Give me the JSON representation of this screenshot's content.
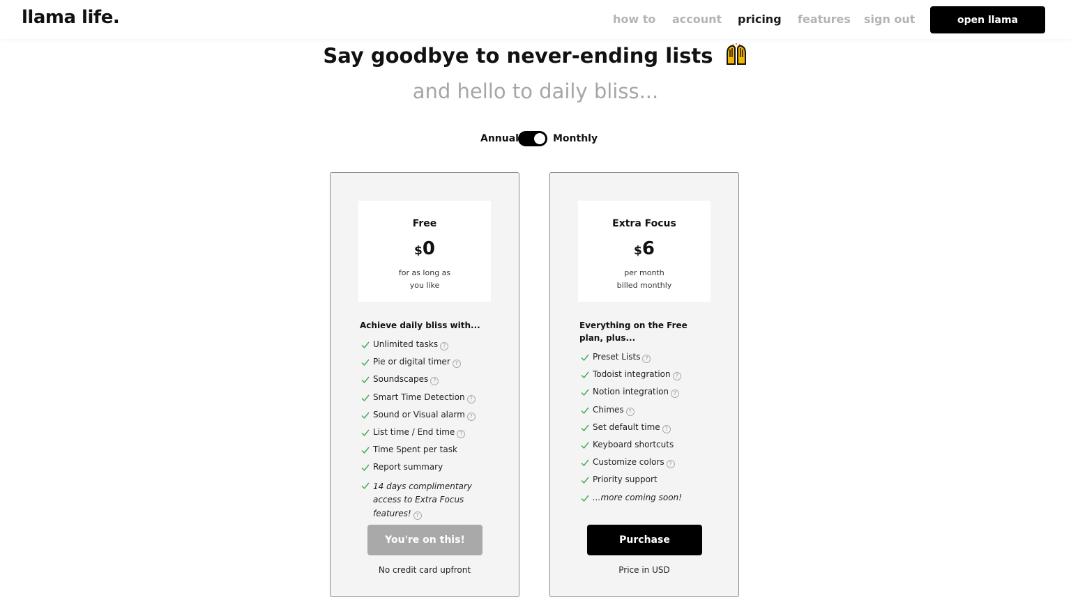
{
  "brand": {
    "logo": "llama life."
  },
  "nav": {
    "items": [
      {
        "label": "how to",
        "active": false
      },
      {
        "label": "account",
        "active": false
      },
      {
        "label": "pricing",
        "active": true
      },
      {
        "label": "features",
        "active": false
      },
      {
        "label": "sign out",
        "active": false
      }
    ],
    "cta_label": "open llama"
  },
  "hero": {
    "title": "Say goodbye to never-ending lists",
    "title_icon": "raising-hands-emoji",
    "subtitle": "and hello to daily bliss..."
  },
  "billing_toggle": {
    "left_label": "Annual",
    "right_label": "Monthly",
    "selected": "Monthly"
  },
  "plans": [
    {
      "name": "Free",
      "currency": "$",
      "price": "0",
      "note_line1": "for as long as",
      "note_line2": "you like",
      "intro": "Achieve daily bliss with...",
      "features": [
        "Unlimited tasks",
        "Pie or digital timer",
        "Soundscapes",
        "Smart Time Detection",
        "Sound or Visual alarm",
        "List time / End time",
        "Time Spent per task",
        "Report summary",
        "14 days complimentary access to Extra Focus features!"
      ],
      "button_label": "You're on this!",
      "footnote": "No credit card upfront"
    },
    {
      "name": "Extra Focus",
      "currency": "$",
      "price": "6",
      "note_line1": "per month",
      "note_line2": "billed monthly",
      "intro": "Everything on the Free plan, plus...",
      "features": [
        "Preset Lists",
        "Todoist integration",
        "Notion integration",
        "Chimes",
        "Set default time",
        "Keyboard shortcuts",
        "Customize colors",
        "Priority support",
        "...more coming soon!"
      ],
      "button_label": "Purchase",
      "footnote": "Price in USD"
    }
  ],
  "colors": {
    "accent": "#000000",
    "check": "#3aa856",
    "muted_nav": "#b3b3b3",
    "card_bg": "#f4f4f4",
    "disabled_button": "#a9a9a9"
  }
}
